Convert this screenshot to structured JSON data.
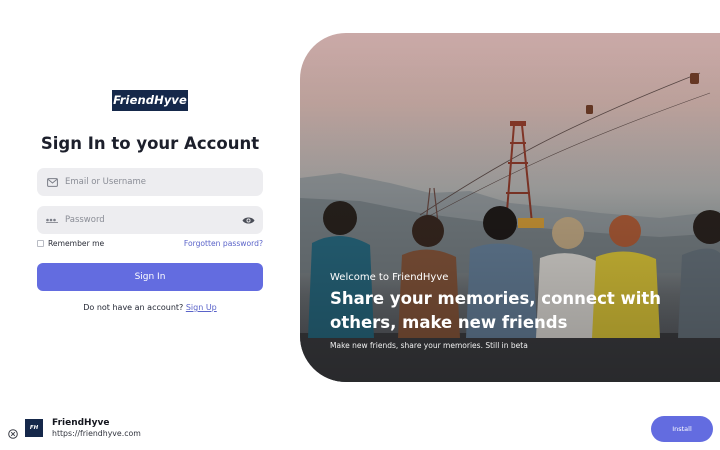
{
  "logo": {
    "text": "FriendHyve"
  },
  "form": {
    "title": "Sign In to your Account",
    "email": {
      "placeholder": "Email or Username",
      "value": "",
      "icon": "envelope-icon"
    },
    "password": {
      "placeholder": "Password",
      "value": "",
      "icon": "password-dots-icon",
      "toggle_icon": "eye-icon"
    },
    "remember_label": "Remember me",
    "forgot_label": "Forgotten password?",
    "signin_label": "Sign In",
    "signup_prompt": "Do not have an account?",
    "signup_link": "Sign Up"
  },
  "hero": {
    "welcome": "Welcome to FriendHyve",
    "headline": "Share your memories, connect with others, make new friends",
    "subtext": "Make new friends, share your memories. Still in beta"
  },
  "install_bar": {
    "close_icon": "close-circle-icon",
    "app_icon_text": "FH",
    "app_name": "FriendHyve",
    "app_url": "https://friendhyve.com",
    "install_label": "Install"
  },
  "colors": {
    "brand_navy": "#15284a",
    "accent": "#636ce0",
    "link": "#5a63c9",
    "field_bg": "#ededf0"
  }
}
